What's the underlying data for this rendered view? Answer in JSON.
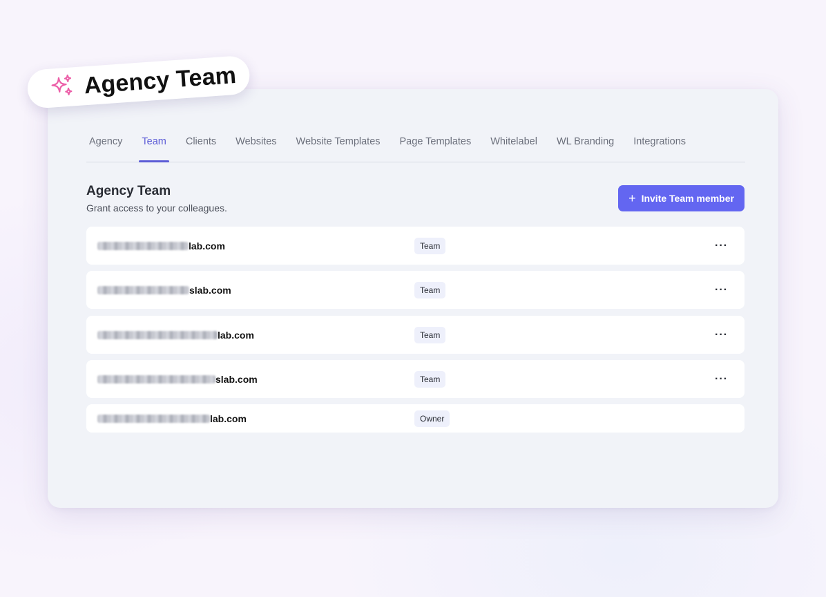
{
  "badge": {
    "title": "Agency Team",
    "icon": "sparkles-icon"
  },
  "tabs": [
    {
      "label": "Agency",
      "active": false
    },
    {
      "label": "Team",
      "active": true
    },
    {
      "label": "Clients",
      "active": false
    },
    {
      "label": "Websites",
      "active": false
    },
    {
      "label": "Website Templates",
      "active": false
    },
    {
      "label": "Page Templates",
      "active": false
    },
    {
      "label": "Whitelabel",
      "active": false
    },
    {
      "label": "WL Branding",
      "active": false
    },
    {
      "label": "Integrations",
      "active": false
    }
  ],
  "section": {
    "title": "Agency Team",
    "subtitle": "Grant access to your colleagues.",
    "invite_label": "Invite Team member",
    "invite_icon": "plus-icon"
  },
  "members": [
    {
      "email_visible": "lab.com",
      "role": "Team",
      "menu": "···"
    },
    {
      "email_visible": "slab.com",
      "role": "Team",
      "menu": "···"
    },
    {
      "email_visible": "lab.com",
      "role": "Team",
      "menu": "···"
    },
    {
      "email_visible": "slab.com",
      "role": "Team",
      "menu": "···"
    },
    {
      "email_visible": "lab.com",
      "role": "Owner",
      "menu": ""
    }
  ],
  "colors": {
    "accent": "#6366f1",
    "sparkle": "#ec5fa8"
  }
}
